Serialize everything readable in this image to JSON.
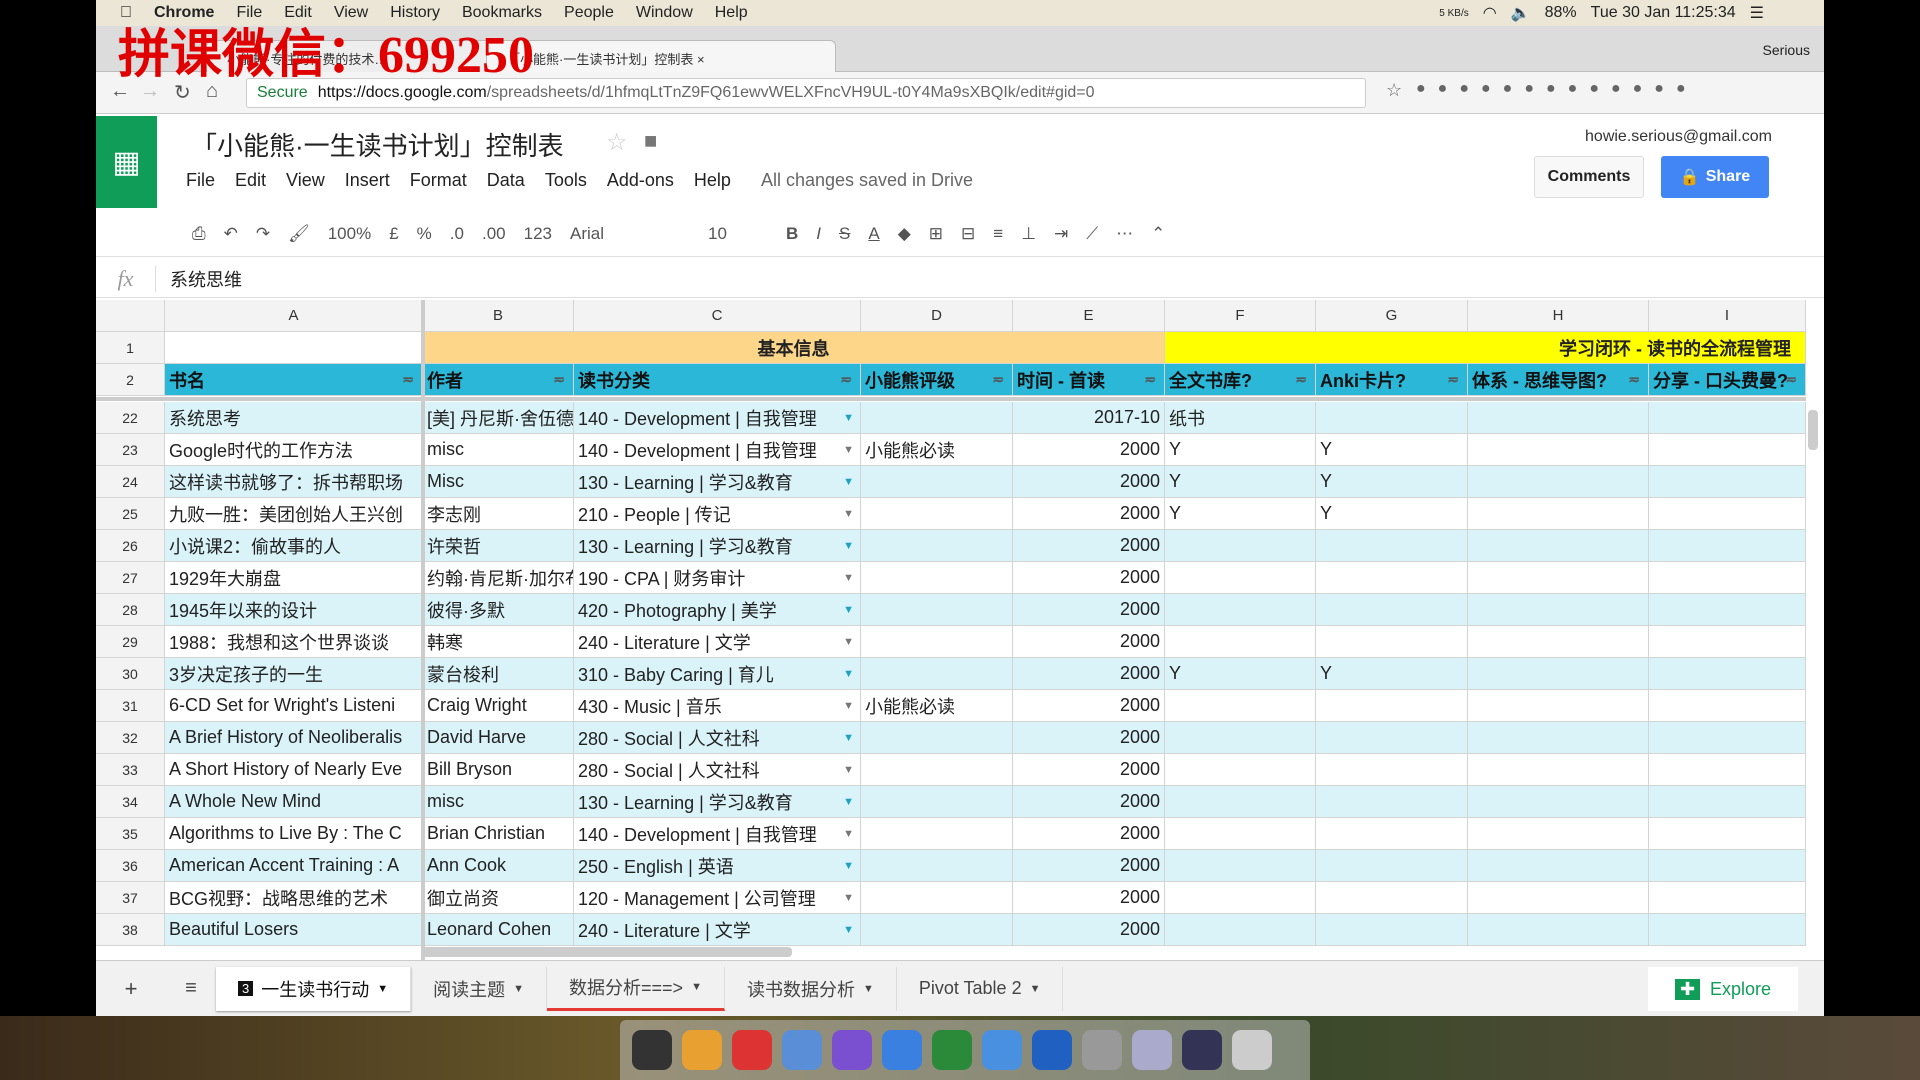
{
  "menubar": {
    "app": "Chrome",
    "items": [
      "File",
      "Edit",
      "View",
      "History",
      "Bookmarks",
      "People",
      "Window",
      "Help"
    ],
    "net": "5 KB/s",
    "battery": "88%",
    "datetime": "Tue 30 Jan  11:25:34"
  },
  "watermark": "拼课微信：699250",
  "browser": {
    "tabs": [
      "小能熊·专注的付费的技术…",
      "「小能熊·一生读书计划」控制表"
    ],
    "profile": "Serious",
    "secure": "Secure",
    "url_host": "https://docs.google.com",
    "url_rest": "/spreadsheets/d/1hfmqLtTnZ9FQ61ewvWELXFncVH9UL-t0Y4Ma9sXBQIk/edit#gid=0"
  },
  "sheet": {
    "title": "「小能熊·一生读书计划」控制表",
    "menus": [
      "File",
      "Edit",
      "View",
      "Insert",
      "Format",
      "Data",
      "Tools",
      "Add-ons",
      "Help"
    ],
    "saved": "All changes saved in Drive",
    "account": "howie.serious@gmail.com",
    "comments": "Comments",
    "share": "Share"
  },
  "toolbar": {
    "zoom": "100%",
    "currency": "£",
    "percent": "%",
    "dec_less": ".0",
    "dec_more": ".00",
    "format": "123",
    "font": "Arial",
    "size": "10"
  },
  "formula": {
    "fx": "fx",
    "value": "系统思维"
  },
  "columns": [
    "A",
    "B",
    "C",
    "D",
    "E",
    "F",
    "G",
    "H",
    "I"
  ],
  "row1": {
    "num": "1",
    "group1": "基本信息",
    "group2": "学习闭环 - 读书的全流程管理"
  },
  "row2": {
    "num": "2",
    "headers": [
      "书名",
      "作者",
      "读书分类",
      "小能熊评级",
      "时间 - 首读",
      "全文书库?",
      "Anki卡片?",
      "体系 - 思维导图?",
      "分享 - 口头费曼?"
    ]
  },
  "rows": [
    [
      "22",
      "系统思考",
      "[美] 丹尼斯·舍伍德",
      "140 - Development | 自我管理",
      "",
      "2017-10",
      "纸书",
      ""
    ],
    [
      "23",
      "Google时代的工作方法",
      "misc",
      "140 - Development | 自我管理",
      "小能熊必读",
      "2000",
      "Y",
      "Y"
    ],
    [
      "24",
      "这样读书就够了：拆书帮职场",
      "Misc",
      "130 - Learning | 学习&教育",
      "",
      "2000",
      "Y",
      "Y"
    ],
    [
      "25",
      "九败一胜：美团创始人王兴创",
      "李志刚",
      "210 - People | 传记",
      "",
      "2000",
      "Y",
      "Y"
    ],
    [
      "26",
      "小说课2：偷故事的人",
      "许荣哲",
      "130 - Learning | 学习&教育",
      "",
      "2000",
      "",
      ""
    ],
    [
      "27",
      "1929年大崩盘",
      "约翰·肯尼斯·加尔布",
      "190 - CPA | 财务审计",
      "",
      "2000",
      "",
      ""
    ],
    [
      "28",
      "1945年以来的设计",
      "彼得·多默",
      "420 - Photography | 美学",
      "",
      "2000",
      "",
      ""
    ],
    [
      "29",
      "1988：我想和这个世界谈谈",
      "韩寒",
      "240 - Literature | 文学",
      "",
      "2000",
      "",
      ""
    ],
    [
      "30",
      "3岁决定孩子的一生",
      "蒙台梭利",
      "310 - Baby Caring | 育儿",
      "",
      "2000",
      "Y",
      "Y"
    ],
    [
      "31",
      "6-CD Set for Wright's Listeni",
      "Craig Wright",
      "430 - Music | 音乐",
      "小能熊必读",
      "2000",
      "",
      ""
    ],
    [
      "32",
      "A Brief History of Neoliberalis",
      "David Harve",
      "280 - Social | 人文社科",
      "",
      "2000",
      "",
      ""
    ],
    [
      "33",
      "A Short History of Nearly Eve",
      "Bill Bryson",
      "280 - Social | 人文社科",
      "",
      "2000",
      "",
      ""
    ],
    [
      "34",
      "A Whole New Mind",
      "misc",
      "130 - Learning | 学习&教育",
      "",
      "2000",
      "",
      ""
    ],
    [
      "35",
      "Algorithms to Live By : The C",
      "Brian Christian",
      "140 - Development | 自我管理",
      "",
      "2000",
      "",
      ""
    ],
    [
      "36",
      "American Accent Training : A",
      "Ann Cook",
      "250 - English | 英语",
      "",
      "2000",
      "",
      ""
    ],
    [
      "37",
      "BCG视野：战略思维的艺术",
      "御立尚资",
      "120 - Management | 公司管理",
      "",
      "2000",
      "",
      ""
    ],
    [
      "38",
      "Beautiful Losers",
      "Leonard Cohen",
      "240 - Literature | 文学",
      "",
      "2000",
      "",
      ""
    ]
  ],
  "tabs": [
    {
      "label": "一生读书行动",
      "badge": "3"
    },
    {
      "label": "阅读主题"
    },
    {
      "label": "数据分析===>"
    },
    {
      "label": "读书数据分析"
    },
    {
      "label": "Pivot Table 2"
    }
  ],
  "explore": "Explore",
  "colors": {
    "header": "#2bb8d8",
    "group1": "#fdd68a",
    "group2": "#ffff00",
    "band": "#d9f3f9",
    "sheets_green": "#0f9d58",
    "share_blue": "#4285f4"
  }
}
